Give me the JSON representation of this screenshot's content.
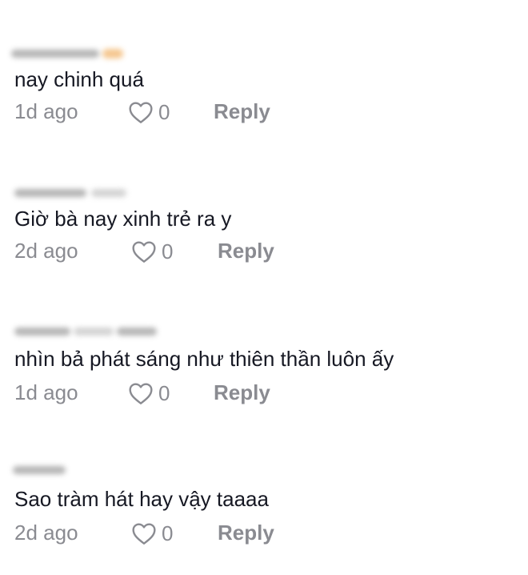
{
  "comments": [
    {
      "text": "nay chinh quá",
      "time": "1d ago",
      "likes": "0",
      "reply_label": "Reply"
    },
    {
      "text": "Giờ bà nay xinh trẻ ra y",
      "time": "2d ago",
      "likes": "0",
      "reply_label": "Reply"
    },
    {
      "text": "nhìn bả phát sáng như thiên thần luôn ấy",
      "time": "1d ago",
      "likes": "0",
      "reply_label": "Reply"
    },
    {
      "text": "Sao tràm hát hay vậy taaaa",
      "time": "2d ago",
      "likes": "0",
      "reply_label": "Reply"
    }
  ],
  "icons": {
    "like": "heart-outline-icon"
  },
  "colors": {
    "text": "#161823",
    "muted": "#8a8b91",
    "username_blur": "#9a9a9a"
  }
}
